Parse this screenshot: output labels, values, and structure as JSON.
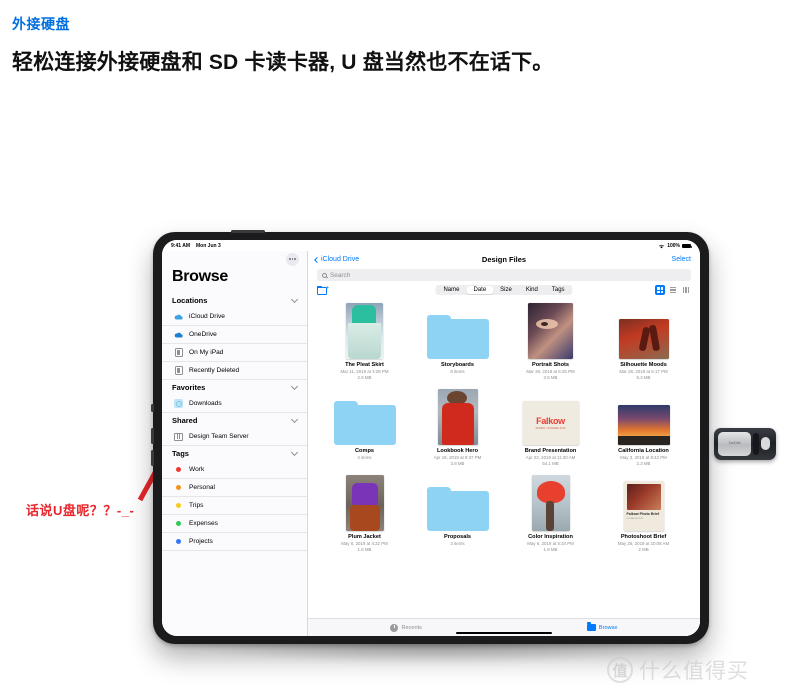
{
  "marketing": {
    "kicker": "外接硬盘",
    "headline": "轻松连接外接硬盘和 SD 卡读卡器, U 盘当然也不在话下。"
  },
  "annotation": {
    "text": "话说U盘呢？？-_-",
    "color": "#e8262b"
  },
  "device": {
    "statusbar": {
      "time": "9:41 AM",
      "date": "Mon Jun 3",
      "wifi_icon": "wifi-icon",
      "battery_percent": "100%",
      "battery_icon": "battery-full-icon"
    },
    "sidebar": {
      "more_icon": "more-dots-icon",
      "title": "Browse",
      "sections": [
        {
          "label": "Locations",
          "chevron_icon": "chevron-down-icon",
          "items": [
            {
              "label": "iCloud Drive",
              "icon": "cloud-icon"
            },
            {
              "label": "OneDrive",
              "icon": "cloud-icon"
            },
            {
              "label": "On My iPad",
              "icon": "device-icon"
            },
            {
              "label": "Recently Deleted",
              "icon": "device-icon"
            }
          ]
        },
        {
          "label": "Favorites",
          "chevron_icon": "chevron-down-icon",
          "items": [
            {
              "label": "Downloads",
              "icon": "downloads-icon"
            }
          ]
        },
        {
          "label": "Shared",
          "chevron_icon": "chevron-down-icon",
          "items": [
            {
              "label": "Design Team Server",
              "icon": "server-icon"
            }
          ]
        },
        {
          "label": "Tags",
          "chevron_icon": "chevron-down-icon",
          "items": [
            {
              "label": "Work",
              "icon": "tag-dot-icon",
              "color": "#ee3b30"
            },
            {
              "label": "Personal",
              "icon": "tag-dot-icon",
              "color": "#f5921e"
            },
            {
              "label": "Trips",
              "icon": "tag-dot-icon",
              "color": "#f8cb1c"
            },
            {
              "label": "Expenses",
              "icon": "tag-dot-icon",
              "color": "#34c759"
            },
            {
              "label": "Projects",
              "icon": "tag-dot-icon",
              "color": "#3478f6"
            }
          ]
        }
      ]
    },
    "navbar": {
      "back_icon": "chevron-left-icon",
      "back_label": "iCloud Drive",
      "title": "Design Files",
      "select_label": "Select"
    },
    "search": {
      "icon": "search-icon",
      "placeholder": "Search",
      "value": ""
    },
    "toolbar": {
      "new_folder_icon": "new-folder-icon",
      "sort_options": [
        "Name",
        "Date",
        "Size",
        "Kind",
        "Tags"
      ],
      "sort_selected": "Date",
      "view_grid_icon": "grid-view-icon",
      "view_list_icon": "list-view-icon",
      "view_column_icon": "column-view-icon",
      "view_selected": "grid-view-icon"
    },
    "files": [
      {
        "name": "The Pleat Skirt",
        "meta1": "Mar 11, 2019 at 3:28 PM",
        "meta2": "2.6 MB",
        "kind": "image",
        "thumb": "t-pleat"
      },
      {
        "name": "Storyboards",
        "meta1": "8 items",
        "meta2": "",
        "kind": "folder",
        "thumb": "folder"
      },
      {
        "name": "Portrait Shots",
        "meta1": "Mar 28, 2019 at 5:25 PM",
        "meta2": "3.5 MB",
        "kind": "image",
        "thumb": "t-portrait"
      },
      {
        "name": "Silhouette Moods",
        "meta1": "Mar 28, 2019 at 6:17 PM",
        "meta2": "5.3 MB",
        "kind": "image",
        "thumb": "t-silhouette"
      },
      {
        "name": "Comps",
        "meta1": "4 items",
        "meta2": "",
        "kind": "folder",
        "thumb": "folder"
      },
      {
        "name": "Lookbook Hero",
        "meta1": "Apr 19, 2019 at 9:37 PM",
        "meta2": "3.8 MB",
        "kind": "image",
        "thumb": "t-lookbook"
      },
      {
        "name": "Brand Presentation",
        "meta1": "Apr 23, 2019 at 11:30 AM",
        "meta2": "54.1 MB",
        "kind": "document",
        "thumb": "t-brand"
      },
      {
        "name": "California Location",
        "meta1": "May 3, 2019 at 8:42 PM",
        "meta2": "2.3 MB",
        "kind": "image",
        "thumb": "t-california"
      },
      {
        "name": "Plum Jacket",
        "meta1": "May 6, 2019 at 4:22 PM",
        "meta2": "1.6 MB",
        "kind": "image",
        "thumb": "t-plum"
      },
      {
        "name": "Proposals",
        "meta1": "3 items",
        "meta2": "",
        "kind": "folder",
        "thumb": "folder"
      },
      {
        "name": "Color Inspiration",
        "meta1": "May 6, 2019 at 5:34 PM",
        "meta2": "1.9 MB",
        "kind": "image",
        "thumb": "t-color"
      },
      {
        "name": "Photoshoot Brief",
        "meta1": "May 26, 2019 at 10:08 AM",
        "meta2": "2 MB",
        "kind": "document",
        "thumb": "t-photoshoot"
      }
    ],
    "brand_thumb": {
      "word": "Falkow",
      "sub": "SPRING / SUMMER 2019"
    },
    "photoshoot_thumb": {
      "title": "Falkow\nPhoto Brief",
      "sub": "LOOKBOOK 2019"
    },
    "tabbar": [
      {
        "label": "Recents",
        "icon": "clock-icon",
        "active": false
      },
      {
        "label": "Browse",
        "icon": "folder-icon",
        "active": true
      }
    ]
  },
  "usb_drive": {
    "brand": "SanDisk",
    "name": "usb-flash-drive"
  },
  "watermark": {
    "mark": "值",
    "text": "什么值得买"
  }
}
